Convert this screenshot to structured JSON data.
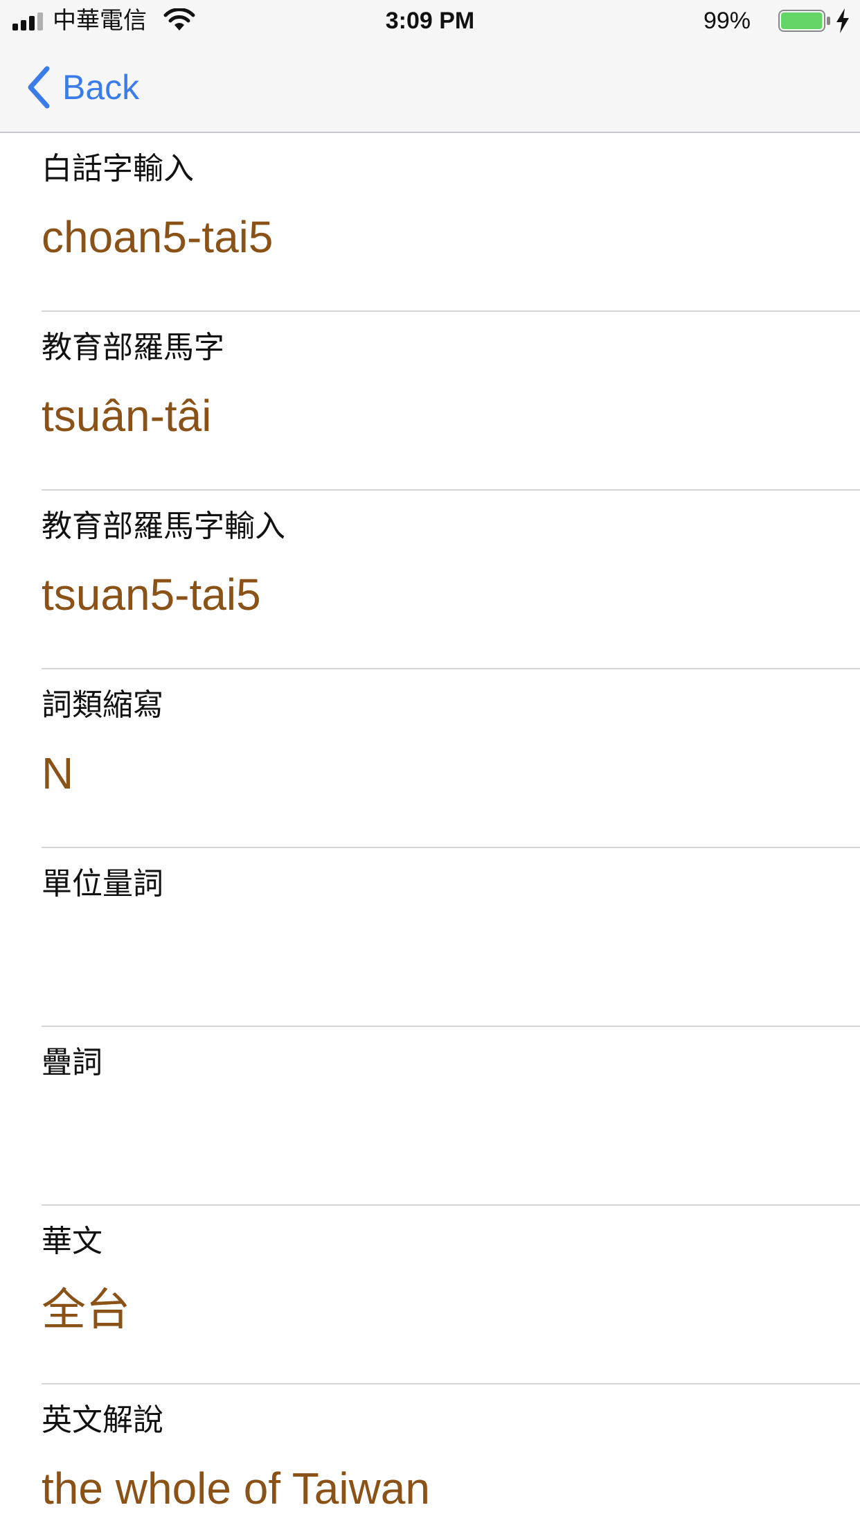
{
  "status_bar": {
    "carrier": "中華電信",
    "time": "3:09 PM",
    "battery_percent": "99%",
    "battery_level": 0.99,
    "battery_color": "#65d466"
  },
  "nav": {
    "back_label": "Back",
    "accent_color": "#3a7cea"
  },
  "entry": {
    "value_color": "#8a5216",
    "fields": [
      {
        "label": "白話字輸入",
        "value": "choan5-tai5"
      },
      {
        "label": "教育部羅馬字",
        "value": "tsuân-tâi"
      },
      {
        "label": "教育部羅馬字輸入",
        "value": "tsuan5-tai5"
      },
      {
        "label": "詞類縮寫",
        "value": "N"
      },
      {
        "label": "單位量詞",
        "value": ""
      },
      {
        "label": "疊詞",
        "value": ""
      },
      {
        "label": "華文",
        "value": "全台"
      },
      {
        "label": "英文解說",
        "value": "the whole of Taiwan"
      }
    ]
  }
}
